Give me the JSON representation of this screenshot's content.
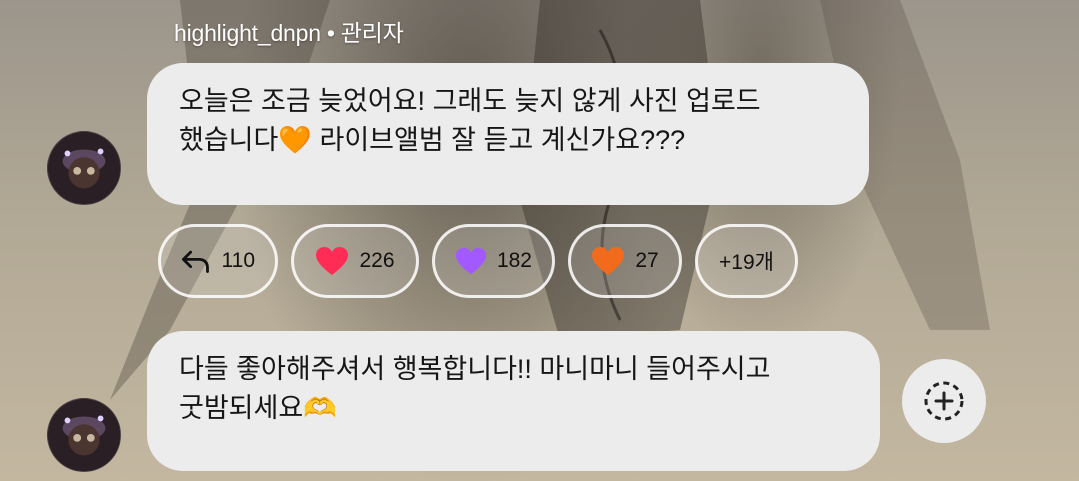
{
  "message_group": {
    "sender_name": "highlight_dnpn",
    "separator": "•",
    "sender_role": "관리자"
  },
  "messages": [
    {
      "lines": [
        "오늘은 조금 늦었어요! 그래도 늦지 않게 사진 업로드",
        "했습니다🧡 라이브앨범 잘 듣고 계신가요???"
      ],
      "avatar_icon": "profile-avatar-icon"
    },
    {
      "lines": [
        "다들 좋아해주셔서 행복합니다!! 마니마니 들어주시고",
        "굿밤되세요🫶"
      ],
      "avatar_icon": "profile-avatar-icon"
    }
  ],
  "reactions": [
    {
      "icon": "reply-arrow-icon",
      "count": "110"
    },
    {
      "icon": "red-heart-icon",
      "count": "226",
      "color": "#ff2d55"
    },
    {
      "icon": "purple-heart-icon",
      "count": "182",
      "color": "#a259ff"
    },
    {
      "icon": "orange-heart-icon",
      "count": "27",
      "color": "#f26b1d"
    },
    {
      "icon": "more-reactions",
      "count": "+19개"
    }
  ],
  "add_reaction_icon": "add-reaction-icon"
}
